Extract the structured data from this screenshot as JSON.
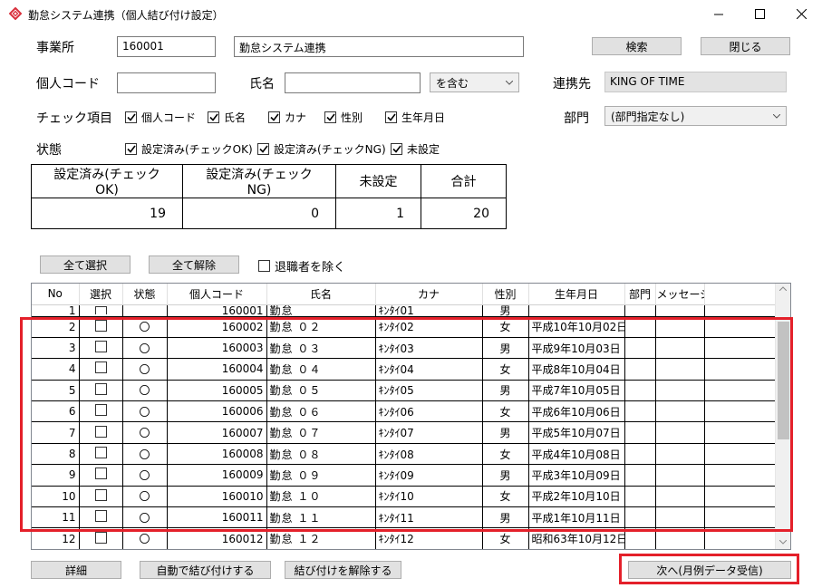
{
  "window": {
    "title": "勤怠システム連携（個人結び付け設定）",
    "minimize": "—",
    "maximize": "☐",
    "close": "✕"
  },
  "form": {
    "office_label": "事業所",
    "office_code": "160001",
    "office_name": "勤怠システム連携",
    "search_button": "検索",
    "close_button": "閉じる",
    "person_code_label": "個人コード",
    "person_code_value": "",
    "name_label": "氏名",
    "name_value": "",
    "match_mode": "を含む",
    "link_target_label": "連携先",
    "link_target_value": "KING OF TIME",
    "check_items_label": "チェック項目",
    "check_items": [
      {
        "label": "個人コード",
        "checked": true
      },
      {
        "label": "氏名",
        "checked": true
      },
      {
        "label": "カナ",
        "checked": true
      },
      {
        "label": "性別",
        "checked": true
      },
      {
        "label": "生年月日",
        "checked": true
      }
    ],
    "dept_label": "部門",
    "dept_value": "(部門指定なし)",
    "status_label": "状態",
    "status_items": [
      {
        "label": "設定済み(チェックOK)",
        "checked": true
      },
      {
        "label": "設定済み(チェックNG)",
        "checked": true
      },
      {
        "label": "未設定",
        "checked": true
      }
    ]
  },
  "summary": {
    "headers": [
      "設定済み(チェックOK)",
      "設定済み(チェックNG)",
      "未設定",
      "合計"
    ],
    "values": [
      "19",
      "0",
      "1",
      "20"
    ]
  },
  "list_controls": {
    "select_all": "全て選択",
    "deselect_all": "全て解除",
    "exclude_retired": "退職者を除く",
    "exclude_retired_checked": false
  },
  "grid": {
    "columns": [
      "No",
      "選択",
      "状態",
      "個人コード",
      "氏名",
      "カナ",
      "性別",
      "生年月日",
      "部門",
      "メッセージ"
    ],
    "rows": [
      {
        "no": "1",
        "status": "",
        "code": "160001",
        "name": "勤怠",
        "kana": "ｷﾝﾀｲ01",
        "sex": "男",
        "birth": ""
      },
      {
        "no": "2",
        "status": "〇",
        "code": "160002",
        "name": "勤怠 ０２",
        "kana": "ｷﾝﾀｲ02",
        "sex": "女",
        "birth": "平成10年10月02日"
      },
      {
        "no": "3",
        "status": "〇",
        "code": "160003",
        "name": "勤怠 ０３",
        "kana": "ｷﾝﾀｲ03",
        "sex": "男",
        "birth": "平成9年10月03日"
      },
      {
        "no": "4",
        "status": "〇",
        "code": "160004",
        "name": "勤怠 ０４",
        "kana": "ｷﾝﾀｲ04",
        "sex": "女",
        "birth": "平成8年10月04日"
      },
      {
        "no": "5",
        "status": "〇",
        "code": "160005",
        "name": "勤怠 ０５",
        "kana": "ｷﾝﾀｲ05",
        "sex": "男",
        "birth": "平成7年10月05日"
      },
      {
        "no": "6",
        "status": "〇",
        "code": "160006",
        "name": "勤怠 ０６",
        "kana": "ｷﾝﾀｲ06",
        "sex": "女",
        "birth": "平成6年10月06日"
      },
      {
        "no": "7",
        "status": "〇",
        "code": "160007",
        "name": "勤怠 ０７",
        "kana": "ｷﾝﾀｲ07",
        "sex": "男",
        "birth": "平成5年10月07日"
      },
      {
        "no": "8",
        "status": "〇",
        "code": "160008",
        "name": "勤怠 ０８",
        "kana": "ｷﾝﾀｲ08",
        "sex": "女",
        "birth": "平成4年10月08日"
      },
      {
        "no": "9",
        "status": "〇",
        "code": "160009",
        "name": "勤怠 ０９",
        "kana": "ｷﾝﾀｲ09",
        "sex": "男",
        "birth": "平成3年10月09日"
      },
      {
        "no": "10",
        "status": "〇",
        "code": "160010",
        "name": "勤怠 １０",
        "kana": "ｷﾝﾀｲ10",
        "sex": "女",
        "birth": "平成2年10月10日"
      },
      {
        "no": "11",
        "status": "〇",
        "code": "160011",
        "name": "勤怠 １１",
        "kana": "ｷﾝﾀｲ11",
        "sex": "男",
        "birth": "平成1年10月11日"
      },
      {
        "no": "12",
        "status": "〇",
        "code": "160012",
        "name": "勤怠 １２",
        "kana": "ｷﾝﾀｲ12",
        "sex": "女",
        "birth": "昭和63年10月12日"
      }
    ]
  },
  "footer": {
    "detail_button": "詳細",
    "auto_link_button": "自動で結び付けする",
    "unlink_button": "結び付けを解除する",
    "next_button": "次へ(月例データ受信)"
  },
  "colors": {
    "highlight": "#e4202a",
    "button_bg": "#e1e1e1",
    "readonly_bg": "#e3e3e3"
  },
  "icons": {
    "app": "app-diamond-icon",
    "dropdown": "chevron-down-icon",
    "check": "check-icon"
  }
}
